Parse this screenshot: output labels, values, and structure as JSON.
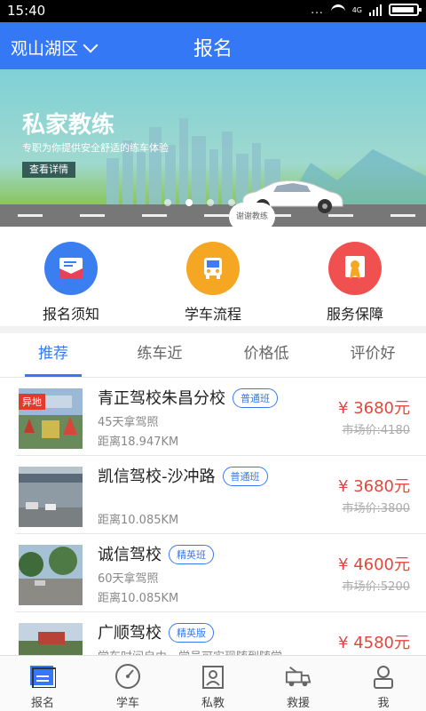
{
  "status": {
    "time": "15:40",
    "dots": "...",
    "net": "4G"
  },
  "header": {
    "city": "观山湖区",
    "title": "报名"
  },
  "banner": {
    "title": "私家教练",
    "subtitle": "专职为你提供安全舒适的练车体验",
    "detail": "查看详情",
    "bubble": "谢谢教练"
  },
  "quick": [
    {
      "label": "报名须知",
      "color": "#3b7ef0",
      "icon": "envelope-icon"
    },
    {
      "label": "学车流程",
      "color": "#f5a623",
      "icon": "bus-icon"
    },
    {
      "label": "服务保障",
      "color": "#f05050",
      "icon": "badge-icon"
    }
  ],
  "tabs": [
    "推荐",
    "练车近",
    "价格低",
    "评价好"
  ],
  "schools": [
    {
      "name": "青正驾校朱昌分校",
      "badge": "普通班",
      "line1": "45天拿驾照",
      "line2": "距离18.947KM",
      "price": "¥ 3680元",
      "market": "市场价:4180",
      "tag": "异地"
    },
    {
      "name": "凯信驾校-沙冲路",
      "badge": "普通班",
      "line1": "",
      "line2": "距离10.085KM",
      "price": "¥ 3680元",
      "market": "市场价:3800"
    },
    {
      "name": "诚信驾校",
      "badge": "精英班",
      "line1": "60天拿驾照",
      "line2": "距离10.085KM",
      "price": "¥ 4600元",
      "market": "市场价:5200"
    },
    {
      "name": "广顺驾校",
      "badge": "精英版",
      "line1": "学车时间自由，学员可实现随到随学",
      "line2": "",
      "price": "¥ 4580元",
      "market": ""
    }
  ],
  "bottom": [
    {
      "label": "报名",
      "icon": "signup-icon"
    },
    {
      "label": "学车",
      "icon": "speedometer-icon"
    },
    {
      "label": "私教",
      "icon": "coach-icon"
    },
    {
      "label": "救援",
      "icon": "rescue-icon"
    },
    {
      "label": "我",
      "icon": "user-icon"
    }
  ]
}
